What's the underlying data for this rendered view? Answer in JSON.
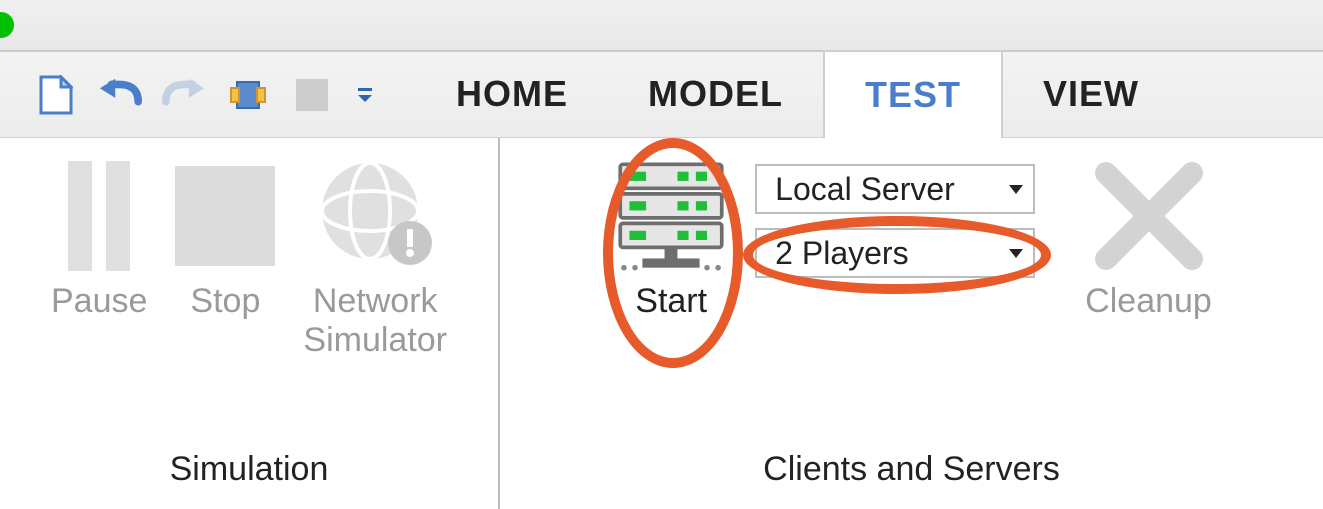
{
  "tabs": {
    "items": [
      "HOME",
      "MODEL",
      "TEST",
      "VIEW"
    ],
    "active_index": 2
  },
  "qat_icons": [
    "new-file-icon",
    "undo-icon",
    "redo-icon",
    "plugin-icon",
    "stop-square-icon",
    "customize-icon"
  ],
  "ribbon": {
    "groups": [
      {
        "title": "Simulation",
        "buttons": [
          {
            "id": "pause",
            "label": "Pause",
            "enabled": false,
            "icon": "pause-icon"
          },
          {
            "id": "stop",
            "label": "Stop",
            "enabled": false,
            "icon": "stop-icon"
          },
          {
            "id": "netsim",
            "label": "Network\nSimulator",
            "enabled": false,
            "icon": "network-icon"
          }
        ]
      },
      {
        "title": "Clients and Servers",
        "buttons": [
          {
            "id": "start",
            "label": "Start",
            "enabled": true,
            "icon": "server-icon"
          },
          {
            "id": "cleanup",
            "label": "Cleanup",
            "enabled": false,
            "icon": "x-icon"
          }
        ],
        "dropdowns": [
          {
            "id": "server_mode",
            "value": "Local Server"
          },
          {
            "id": "player_count",
            "value": "2 Players"
          }
        ]
      }
    ]
  },
  "annotation_targets": [
    "start",
    "player_count"
  ]
}
